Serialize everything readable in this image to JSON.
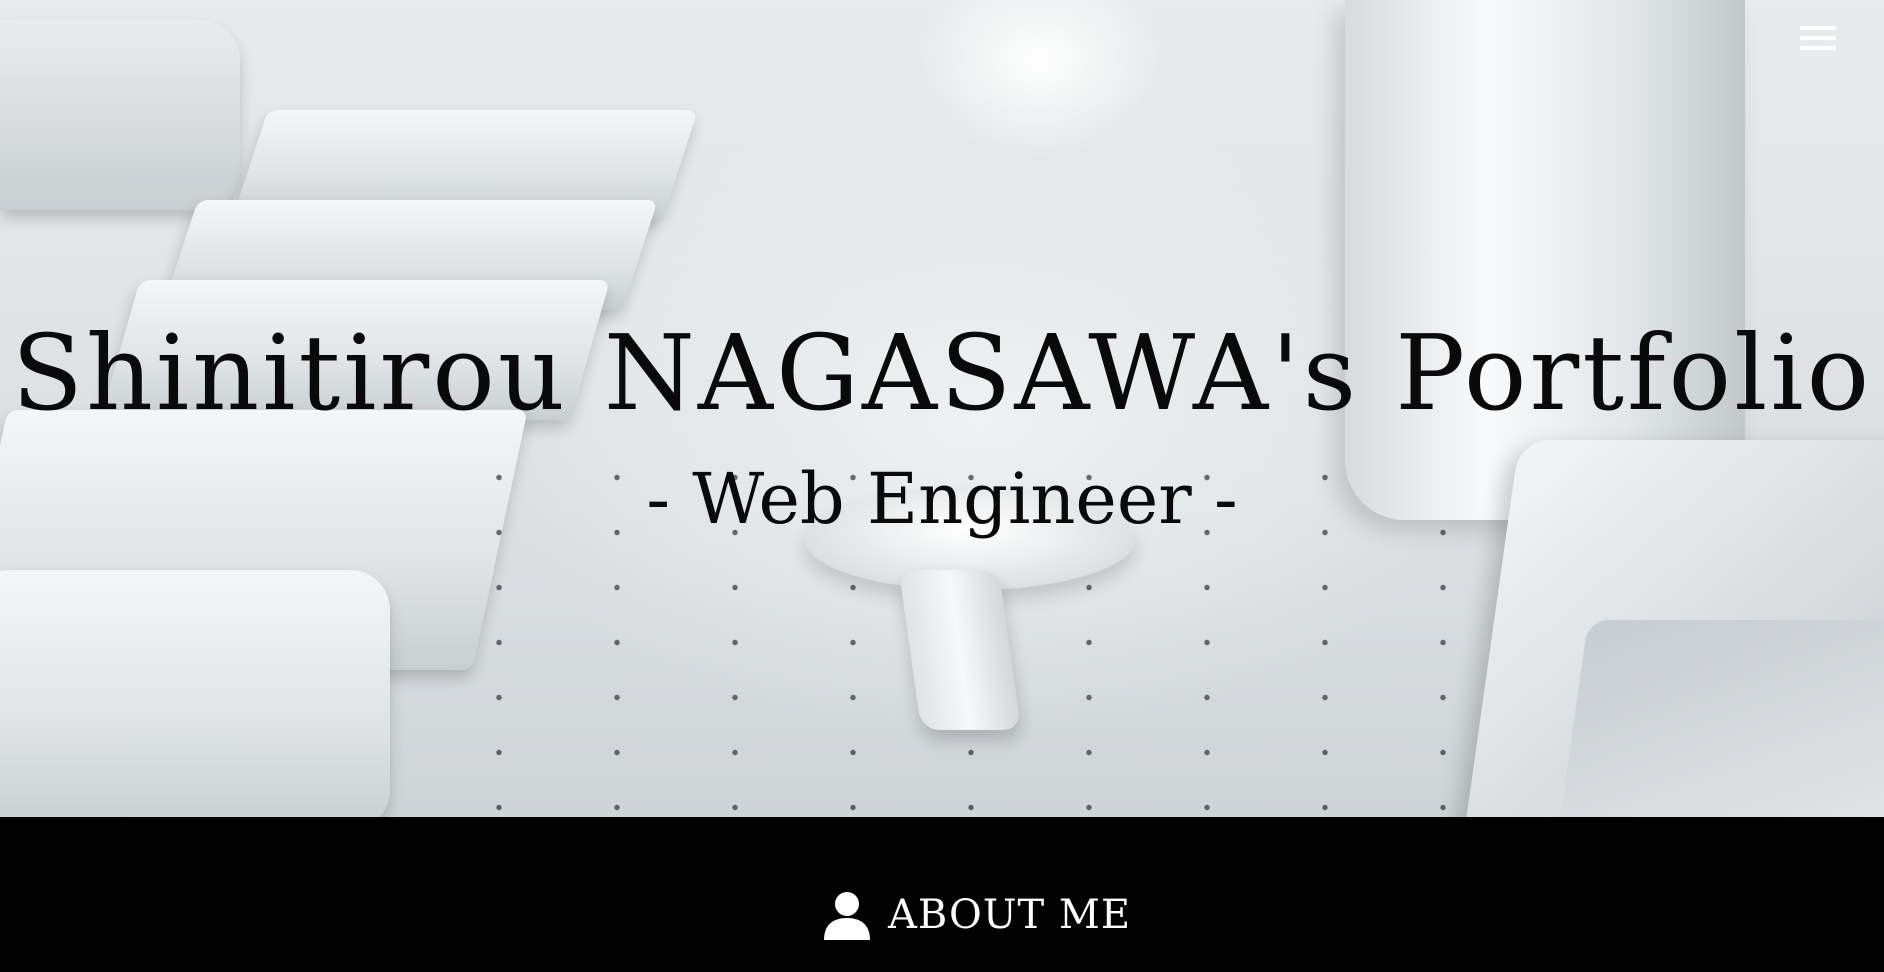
{
  "hero": {
    "title": "Shinitirou NAGASAWA's Portfolio",
    "subtitle": "- Web Engineer -"
  },
  "nav": {
    "menu_icon": "hamburger-menu-icon"
  },
  "sections": {
    "about": {
      "icon": "user-icon",
      "label": "ABOUT ME"
    }
  },
  "colors": {
    "hero_text": "#0a0a0a",
    "section_background": "#020202",
    "section_text": "#ffffff"
  }
}
